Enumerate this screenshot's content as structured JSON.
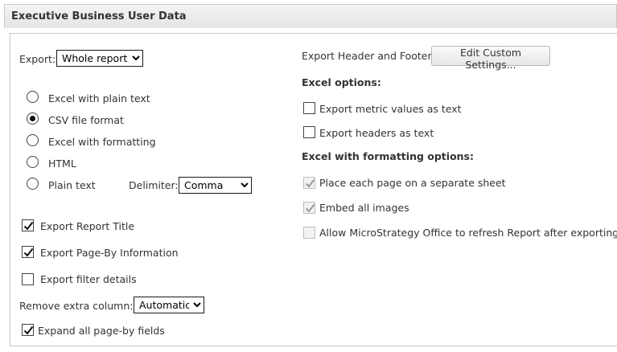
{
  "title": "Executive Business User Data",
  "export": {
    "label": "Export:",
    "selected": "Whole report"
  },
  "formats": [
    {
      "label": "Excel with plain text",
      "selected": false
    },
    {
      "label": "CSV file format",
      "selected": true
    },
    {
      "label": "Excel with formatting",
      "selected": false
    },
    {
      "label": "HTML",
      "selected": false
    },
    {
      "label": "Plain text",
      "selected": false
    }
  ],
  "delimiter": {
    "label": "Delimiter:",
    "selected": "Comma"
  },
  "left_options": {
    "report_title": {
      "label": "Export Report Title",
      "checked": true
    },
    "page_by": {
      "label": "Export Page-By Information",
      "checked": true
    },
    "filter_details": {
      "label": "Export filter details",
      "checked": false
    }
  },
  "remove_column": {
    "label": "Remove extra column:",
    "selected": "Automatic"
  },
  "expand_page_by": {
    "label": "Expand all page-by fields",
    "checked": true
  },
  "header_footer": {
    "label": "Export Header and Footer:",
    "button": "Edit Custom Settings..."
  },
  "excel_options": {
    "heading": "Excel options:",
    "metric_text": {
      "label": "Export metric values as text",
      "checked": false
    },
    "headers_text": {
      "label": "Export headers as text",
      "checked": false
    }
  },
  "formatting_options": {
    "heading": "Excel with formatting options:",
    "separate_sheet": {
      "label": "Place each page on a separate sheet",
      "checked": true,
      "disabled": true
    },
    "embed_images": {
      "label": "Embed all images",
      "checked": true,
      "disabled": true
    },
    "office_refresh": {
      "label": "Allow MicroStrategy Office to refresh Report after exporting",
      "checked": false,
      "disabled": true
    }
  },
  "colors": {
    "border": "#c8c8c8",
    "text": "#333333",
    "disabled_check": "#9a9a9a"
  }
}
